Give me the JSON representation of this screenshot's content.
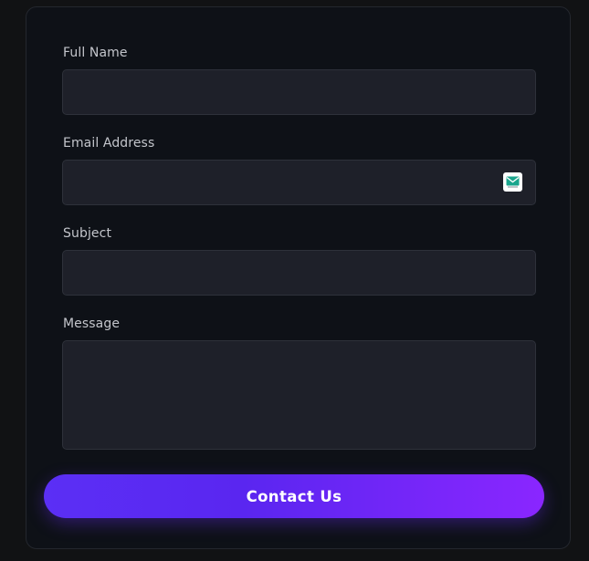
{
  "form": {
    "full_name": {
      "label": "Full Name",
      "value": ""
    },
    "email": {
      "label": "Email Address",
      "value": "",
      "icon": "email-autofill-icon"
    },
    "subject": {
      "label": "Subject",
      "value": ""
    },
    "message": {
      "label": "Message",
      "value": ""
    },
    "submit_label": "Contact Us"
  },
  "colors": {
    "page_background": "#111214",
    "card_background": "#0e1117",
    "field_background": "#1e2029",
    "label_text": "#c3c5cb",
    "button_gradient_start": "#5b2ff5",
    "button_gradient_end": "#8a26ff",
    "icon_accent": "#1aa58d"
  }
}
